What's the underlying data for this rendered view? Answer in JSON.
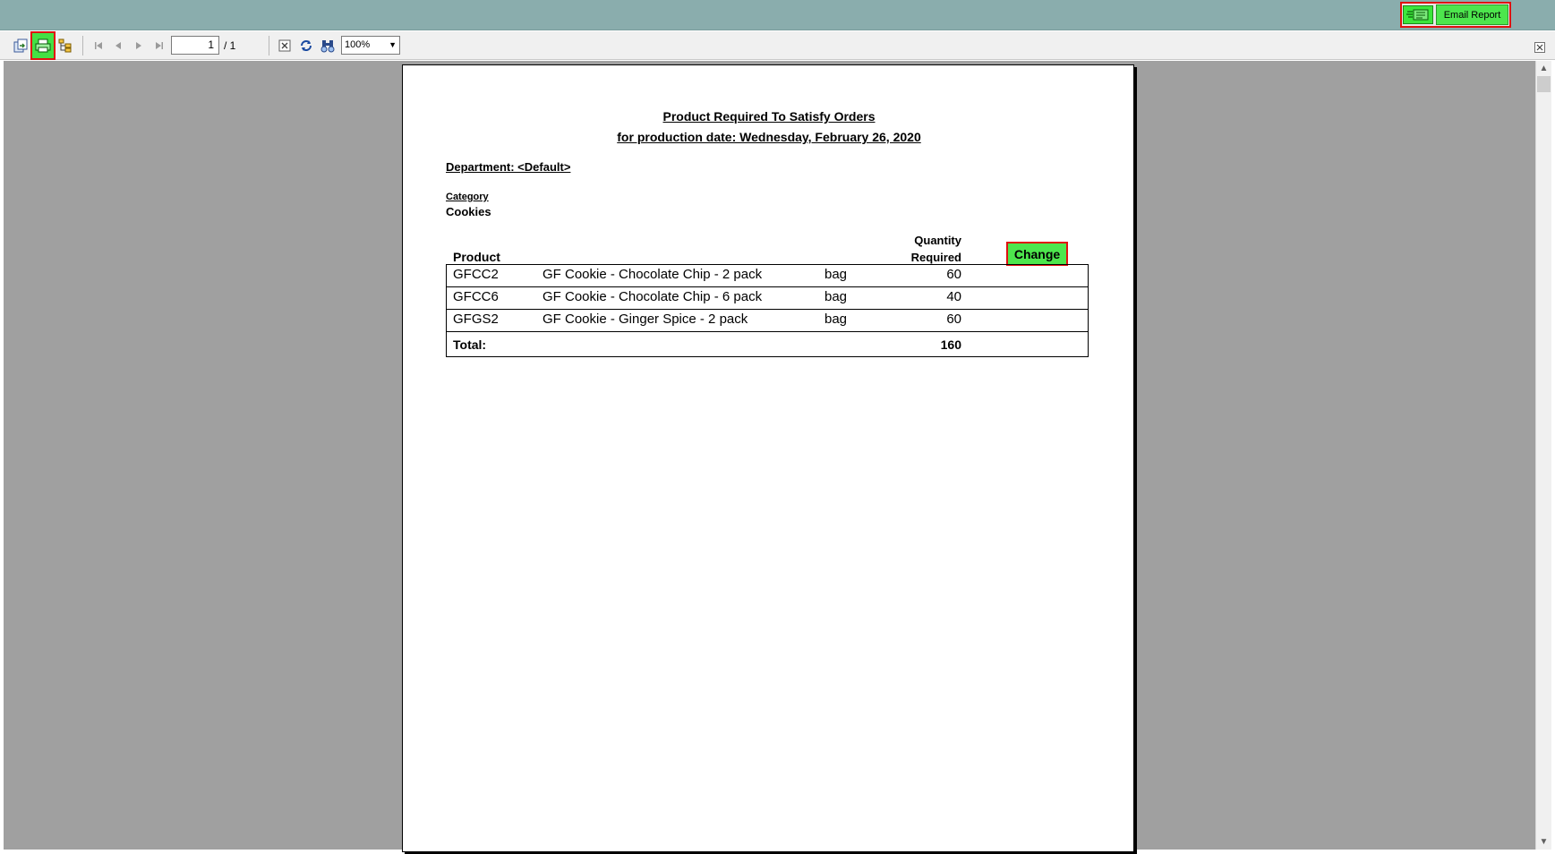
{
  "topbar": {
    "email_button_label": "Email Report"
  },
  "toolbar": {
    "icons": [
      "export-icon",
      "print-icon",
      "group-tree-icon",
      "first-page-icon",
      "prev-page-icon",
      "next-page-icon",
      "last-page-icon",
      "close-view-icon",
      "refresh-icon",
      "search-text-icon",
      "close-icon"
    ],
    "current_page": "1",
    "total_pages": "/ 1",
    "zoom": "100%"
  },
  "report": {
    "title_line1": "Product Required To Satisfy Orders",
    "title_line2": "for production date: Wednesday, February 26, 2020",
    "department": "Department: <Default>",
    "category_label": "Category",
    "category_value": "Cookies",
    "col_product": "Product",
    "col_quantity_line1": "Quantity",
    "col_quantity_line2": "Required",
    "change_button": "Change",
    "rows": [
      {
        "code": "GFCC2",
        "description": "GF Cookie - Chocolate Chip - 2 pack",
        "unit": "bag",
        "qty": "60"
      },
      {
        "code": "GFCC6",
        "description": "GF Cookie - Chocolate Chip - 6 pack",
        "unit": "bag",
        "qty": "40"
      },
      {
        "code": "GFGS2",
        "description": "GF Cookie - Ginger Spice - 2 pack",
        "unit": "bag",
        "qty": "60"
      }
    ],
    "total_label": "Total:",
    "total_value": "160"
  },
  "colors": {
    "topbar": "#8aadad",
    "highlight_green": "#4de64d",
    "highlight_border": "#e01010",
    "viewer_bg": "#a0a0a0"
  }
}
